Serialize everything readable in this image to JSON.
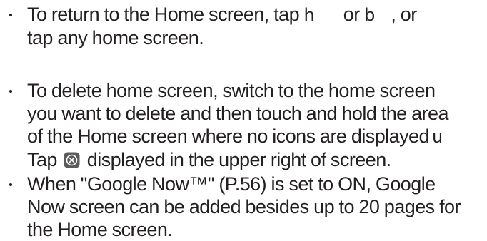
{
  "bullets": [
    {
      "line1_part1": "To return to the Home screen, tap",
      "key1_glyph": "h",
      "line1_or": "or",
      "key2_glyph": "b",
      "line1_end": ", or",
      "line2": "tap any home screen."
    },
    {
      "line1": "To delete home screen, switch to the home screen",
      "line2": "you want to delete and then touch and hold the area",
      "line3_text": "of the Home screen where no icons are displayed",
      "line3_glyph": "u",
      "line4_start": "Tap",
      "icon": "close-icon",
      "line4_end": "displayed in the upper right of screen."
    },
    {
      "line1": "When \"Google Now™\" (P.56) is set to ON, Google",
      "line2": "Now screen can be added besides up to 20 pages for",
      "line3": "the Home screen."
    }
  ],
  "colors": {
    "text": "#231f20",
    "icon_fill": "#5b5b5b",
    "icon_glyph": "#ffffff"
  }
}
